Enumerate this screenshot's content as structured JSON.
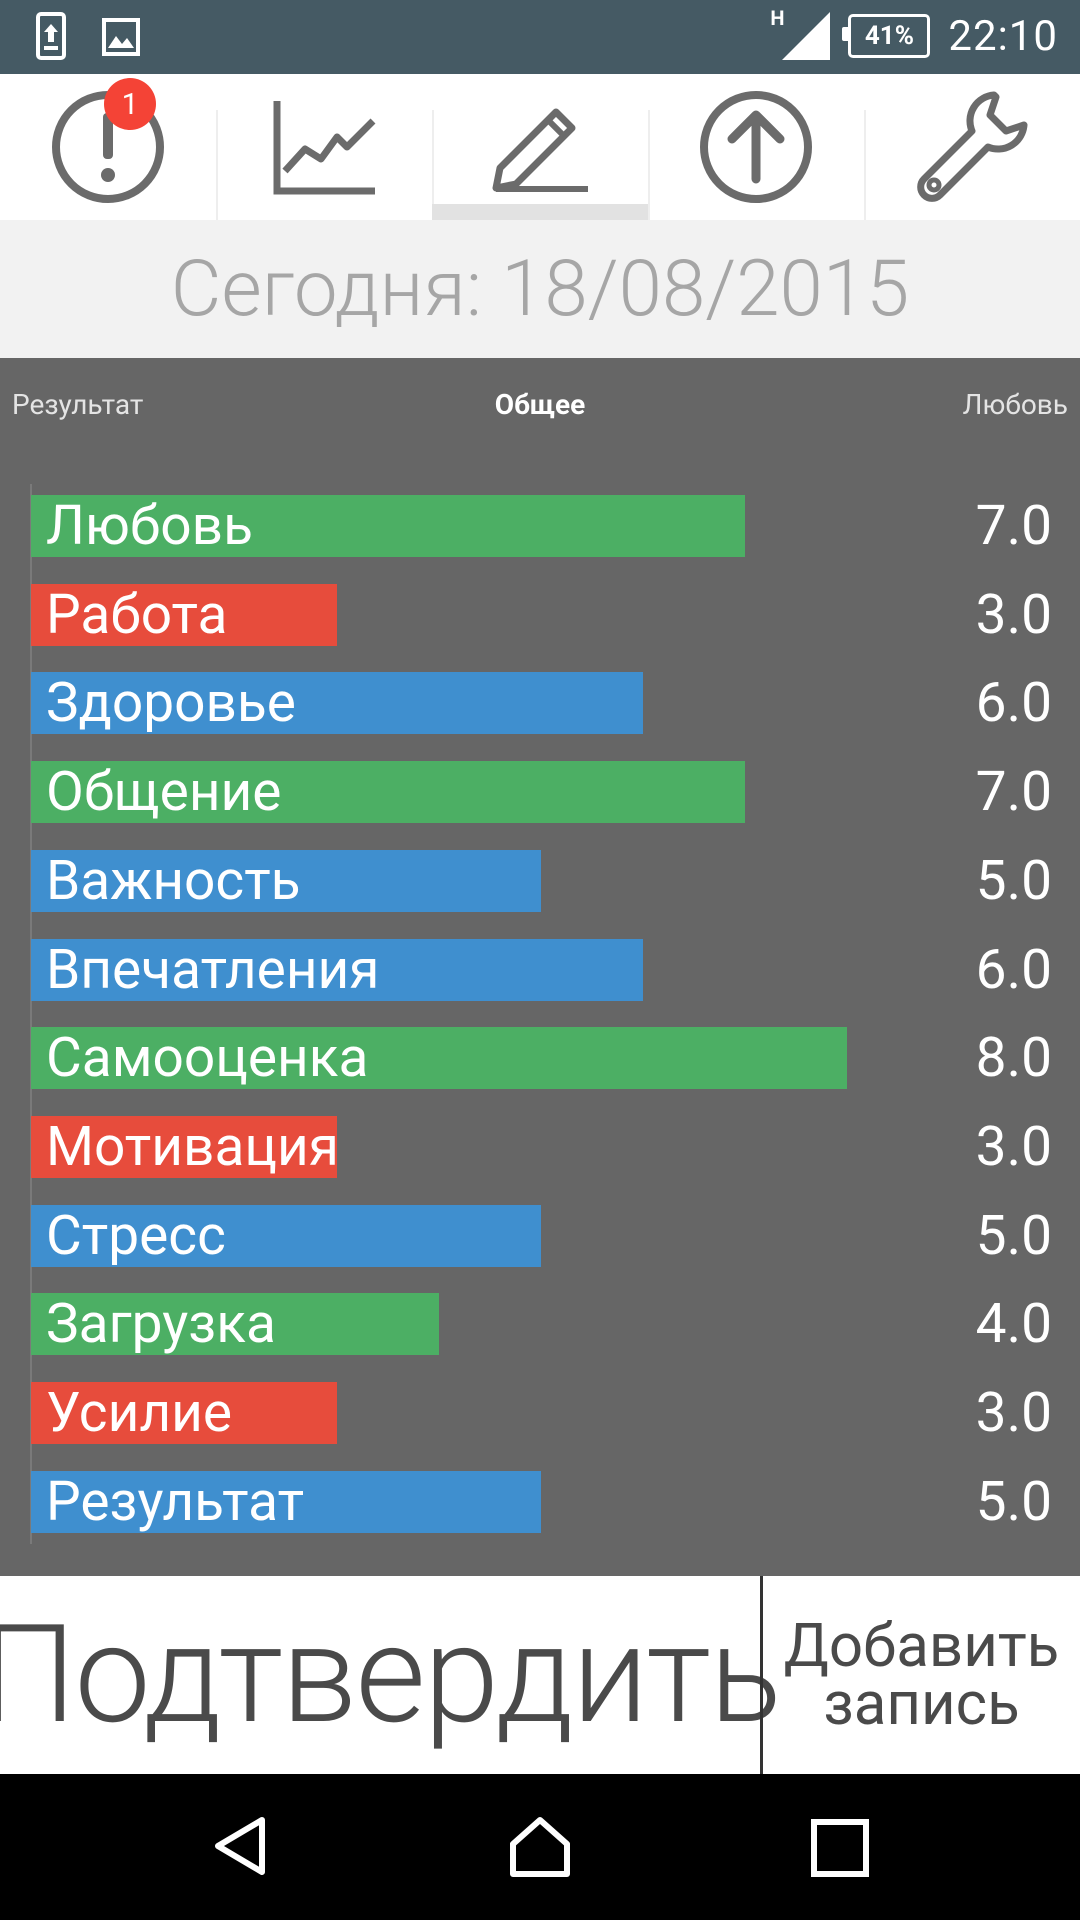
{
  "statusbar": {
    "network": "H",
    "battery": "41%",
    "time": "22:10",
    "icons": [
      "upload-screenshot-icon",
      "image-icon",
      "signal-icon",
      "battery-icon"
    ]
  },
  "tabs": [
    {
      "name": "alerts",
      "icon": "exclamation-circle-icon",
      "badge": "1"
    },
    {
      "name": "stats",
      "icon": "line-chart-icon"
    },
    {
      "name": "edit",
      "icon": "pencil-icon",
      "active": true
    },
    {
      "name": "upload",
      "icon": "arrow-up-circle-icon"
    },
    {
      "name": "settings",
      "icon": "wrench-icon"
    }
  ],
  "date_header": "Сегодня: 18/08/2015",
  "panel": {
    "left_label": "Результат",
    "center_label": "Общее",
    "right_label": "Любовь"
  },
  "chart_data": {
    "type": "bar",
    "orientation": "horizontal",
    "categories": [
      "Любовь",
      "Работа",
      "Здоровье",
      "Общение",
      "Важность",
      "Впечатления",
      "Самооценка",
      "Мотивация",
      "Стресс",
      "Загрузка",
      "Усилие",
      "Результат"
    ],
    "values": [
      7.0,
      3.0,
      6.0,
      7.0,
      5.0,
      6.0,
      8.0,
      3.0,
      5.0,
      4.0,
      3.0,
      5.0
    ],
    "value_labels": [
      "7.0",
      "3.0",
      "6.0",
      "7.0",
      "5.0",
      "6.0",
      "8.0",
      "3.0",
      "5.0",
      "4.0",
      "3.0",
      "5.0"
    ],
    "colors": [
      "#4caf64",
      "#e74c3c",
      "#3f8fcf",
      "#4caf64",
      "#3f8fcf",
      "#3f8fcf",
      "#4caf64",
      "#e74c3c",
      "#3f8fcf",
      "#4caf64",
      "#e74c3c",
      "#3f8fcf"
    ],
    "xlim": [
      0,
      12
    ],
    "grid": false
  },
  "actions": {
    "confirm": "Подтвердить",
    "add_line1": "Добавить",
    "add_line2": "запись"
  },
  "navbar": {
    "buttons": [
      "back-icon",
      "home-icon",
      "recents-icon"
    ]
  },
  "colors": {
    "statusbar": "#455a64",
    "panel": "#666666",
    "green": "#4caf64",
    "red": "#e74c3c",
    "blue": "#3f8fcf",
    "badge": "#f44336"
  }
}
